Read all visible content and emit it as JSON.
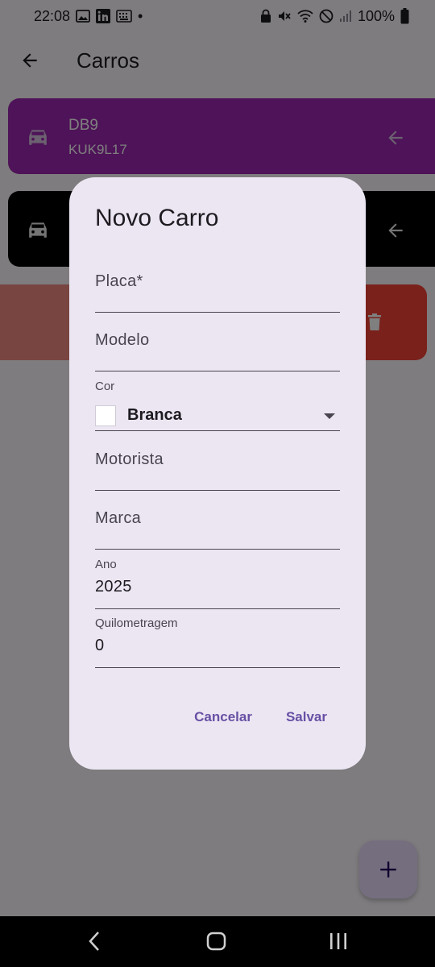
{
  "status_bar": {
    "time": "22:08",
    "dot": "•",
    "battery_percent": "100%",
    "icons_left": [
      "gallery-icon",
      "linkedin-icon",
      "keyboard-icon"
    ],
    "icons_right": [
      "lock-icon",
      "mute-icon",
      "wifi-icon",
      "dnd-icon",
      "signal-icon",
      "battery-icon"
    ]
  },
  "app_bar": {
    "title": "Carros",
    "back_icon": "arrow-left-icon"
  },
  "list": {
    "items": [
      {
        "model": "DB9",
        "plate": "KUK9L17",
        "color": "#9c27b0"
      },
      {
        "model": "",
        "plate": "",
        "color": "#000000"
      }
    ],
    "delete_icon": "trash-icon"
  },
  "dialog": {
    "title": "Novo Carro",
    "fields": {
      "placa": {
        "placeholder": "Placa*"
      },
      "modelo": {
        "placeholder": "Modelo"
      },
      "cor": {
        "label": "Cor",
        "value": "Branca",
        "swatch": "#ffffff"
      },
      "motorista": {
        "placeholder": "Motorista"
      },
      "marca": {
        "placeholder": "Marca"
      },
      "ano": {
        "label": "Ano",
        "value": "2025"
      },
      "quilometragem": {
        "label": "Quilometragem",
        "value": "0"
      }
    },
    "cancel_label": "Cancelar",
    "save_label": "Salvar"
  },
  "fab": {
    "icon": "plus-icon"
  },
  "colors": {
    "accent": "#6750a4",
    "delete": "#f44336"
  }
}
